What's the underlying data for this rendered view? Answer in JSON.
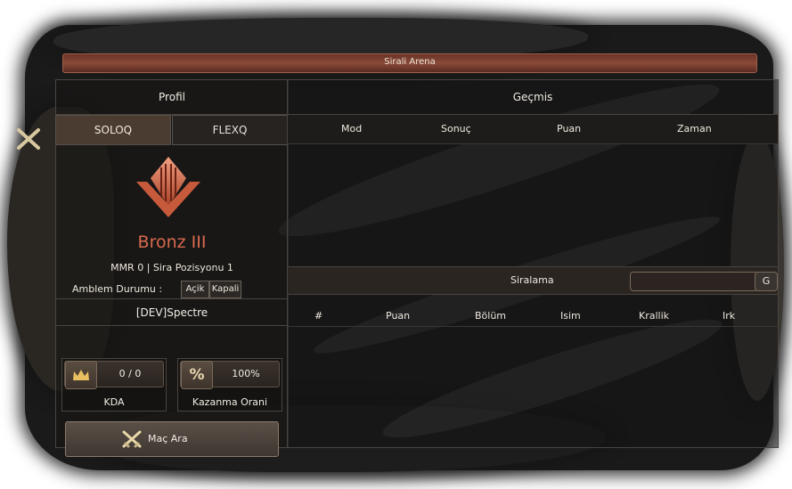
{
  "window": {
    "title": "Sirali Arena"
  },
  "profile": {
    "header": "Profil",
    "tabs": [
      {
        "label": "SOLOQ",
        "active": true
      },
      {
        "label": "FLEXQ",
        "active": false
      }
    ],
    "rank": "Bronz III",
    "mmr_line": "MMR 0 | Sira Pozisyonu 1",
    "emblem_label": "Amblem Durumu :",
    "emblem_on": "Açik",
    "emblem_off": "Kapali",
    "player_name": "[DEV]Spectre",
    "kda_value": "0 / 0",
    "kda_label": "KDA",
    "win_value": "100%",
    "win_label": "Kazanma Orani",
    "match_button": "Maç Ara"
  },
  "history": {
    "header": "Geçmis",
    "columns": [
      "Mod",
      "Sonuç",
      "Puan",
      "Zaman"
    ]
  },
  "ranking": {
    "header": "Siralama",
    "search_button": "G",
    "columns": [
      "#",
      "Puan",
      "Bölüm",
      "Isim",
      "Krallik",
      "Irk"
    ]
  },
  "colors": {
    "accent": "#d96a4e",
    "title_bar": "#8a4a38"
  },
  "icons": [
    "emblem-icon",
    "crown-icon",
    "percent-icon",
    "crossed-swords-icon"
  ]
}
